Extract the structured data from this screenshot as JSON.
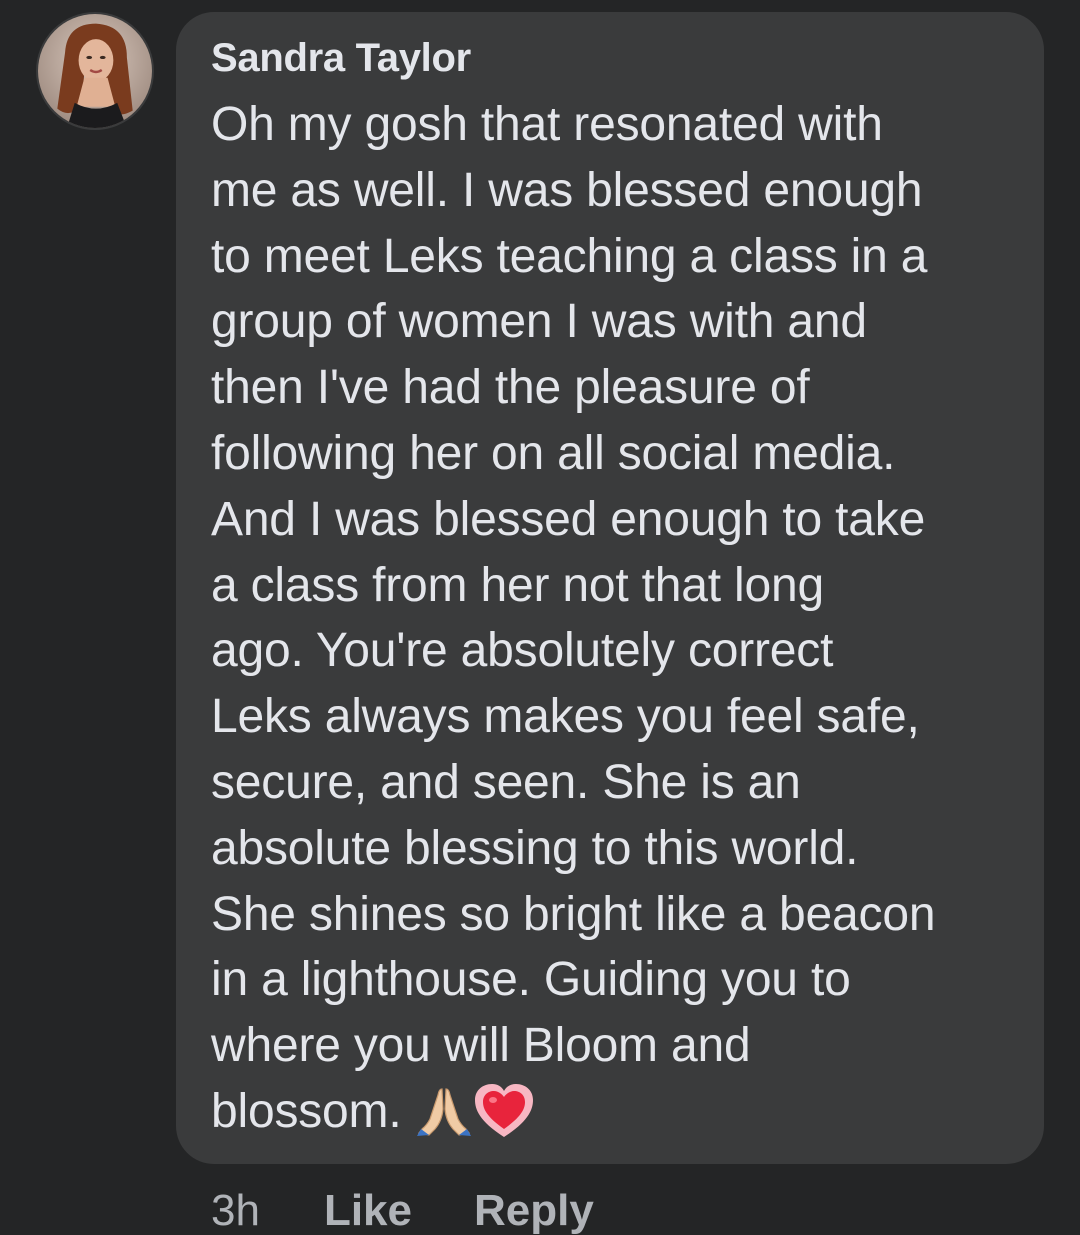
{
  "comment": {
    "author": "Sandra Taylor",
    "lines": [
      "Oh my gosh that resonated with",
      "me as well. I was blessed enough",
      "to meet Leks teaching a class in a",
      "group of women I was with and",
      "then I've had the pleasure of",
      "following her on all social media.",
      "And I was blessed enough to take",
      "a class from her not that long",
      "ago. You're absolutely correct",
      "Leks always makes you feel safe,",
      "secure, and seen. She is an",
      "absolute blessing to this world.",
      "She shines so bright like a beacon",
      "in a lighthouse. Guiding you to",
      "where you will Bloom and",
      "blossom."
    ],
    "emojis": [
      "folded-hands-icon",
      "heart-icon"
    ],
    "timestamp": "3h",
    "like_label": "Like",
    "reply_label": "Reply"
  },
  "colors": {
    "background": "#242526",
    "bubble": "#3a3b3c",
    "text": "#e4e6eb",
    "secondary_text": "#b0b3b8"
  }
}
